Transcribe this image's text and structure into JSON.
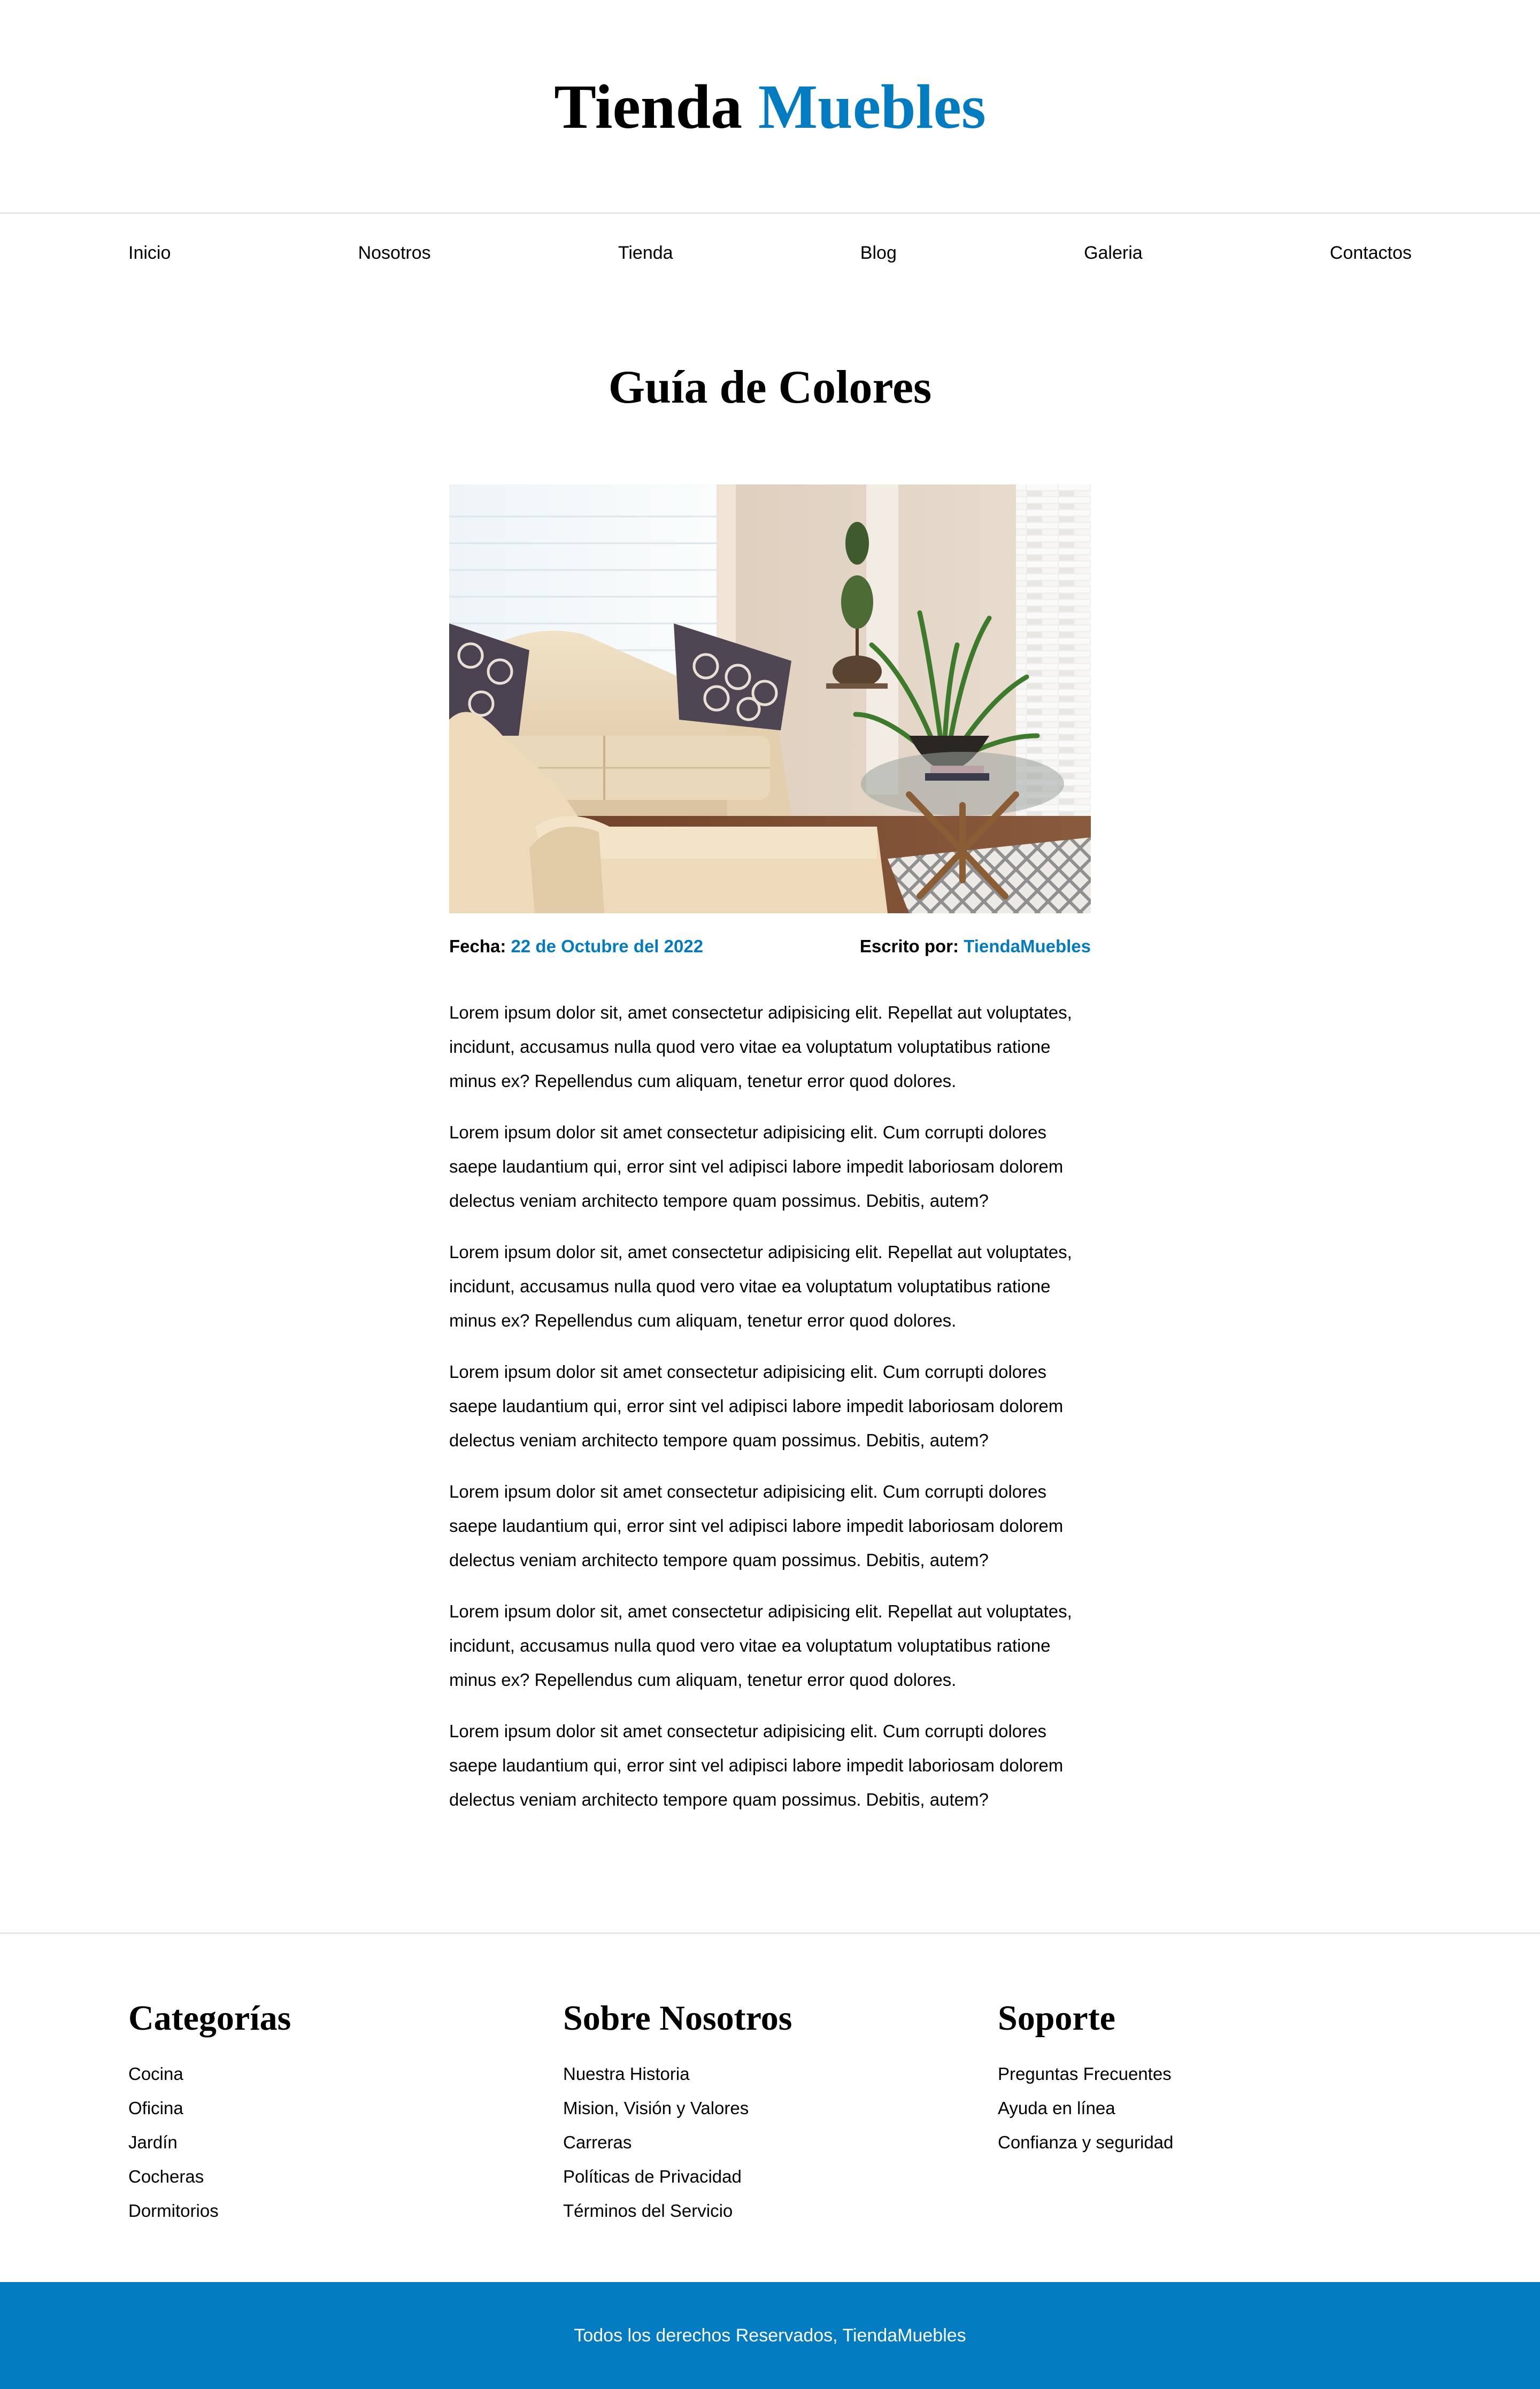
{
  "header": {
    "logo_part1": "Tienda",
    "logo_part2": "Muebles"
  },
  "nav": {
    "items": [
      "Inicio",
      "Nosotros",
      "Tienda",
      "Blog",
      "Galeria",
      "Contactos"
    ]
  },
  "article": {
    "title": "Guía de Colores",
    "image_alt": "living-room-photo",
    "date_label": "Fecha:",
    "date_value": "22 de Octubre del 2022",
    "author_label": "Escrito por:",
    "author_value": "TiendaMuebles",
    "paragraphs": [
      "Lorem ipsum dolor sit, amet consectetur adipisicing elit. Repellat aut voluptates, incidunt, accusamus nulla quod vero vitae ea voluptatum voluptatibus ratione minus ex? Repellendus cum aliquam, tenetur error quod dolores.",
      "Lorem ipsum dolor sit amet consectetur adipisicing elit. Cum corrupti dolores saepe laudantium qui, error sint vel adipisci labore impedit laboriosam dolorem delectus veniam architecto tempore quam possimus. Debitis, autem?",
      "Lorem ipsum dolor sit, amet consectetur adipisicing elit. Repellat aut voluptates, incidunt, accusamus nulla quod vero vitae ea voluptatum voluptatibus ratione minus ex? Repellendus cum aliquam, tenetur error quod dolores.",
      "Lorem ipsum dolor sit amet consectetur adipisicing elit. Cum corrupti dolores saepe laudantium qui, error sint vel adipisci labore impedit laboriosam dolorem delectus veniam architecto tempore quam possimus. Debitis, autem?",
      "Lorem ipsum dolor sit amet consectetur adipisicing elit. Cum corrupti dolores saepe laudantium qui, error sint vel adipisci labore impedit laboriosam dolorem delectus veniam architecto tempore quam possimus. Debitis, autem?",
      "Lorem ipsum dolor sit, amet consectetur adipisicing elit. Repellat aut voluptates, incidunt, accusamus nulla quod vero vitae ea voluptatum voluptatibus ratione minus ex? Repellendus cum aliquam, tenetur error quod dolores.",
      "Lorem ipsum dolor sit amet consectetur adipisicing elit. Cum corrupti dolores saepe laudantium qui, error sint vel adipisci labore impedit laboriosam dolorem delectus veniam architecto tempore quam possimus. Debitis, autem?"
    ]
  },
  "footer": {
    "columns": [
      {
        "heading": "Categorías",
        "links": [
          "Cocina",
          "Oficina",
          "Jardín",
          "Cocheras",
          "Dormitorios"
        ]
      },
      {
        "heading": "Sobre Nosotros",
        "links": [
          "Nuestra Historia",
          "Mision, Visión y Valores",
          "Carreras",
          "Políticas de Privacidad",
          "Términos del Servicio"
        ]
      },
      {
        "heading": "Soporte",
        "links": [
          "Preguntas Frecuentes",
          "Ayuda en línea",
          "Confianza y seguridad"
        ]
      }
    ],
    "copyright": "Todos los derechos Reservados, TiendaMuebles"
  },
  "colors": {
    "accent": "#037bc0",
    "text": "#000000",
    "divider": "#e6e6e6",
    "footer_bar_text": "#ffffff"
  }
}
